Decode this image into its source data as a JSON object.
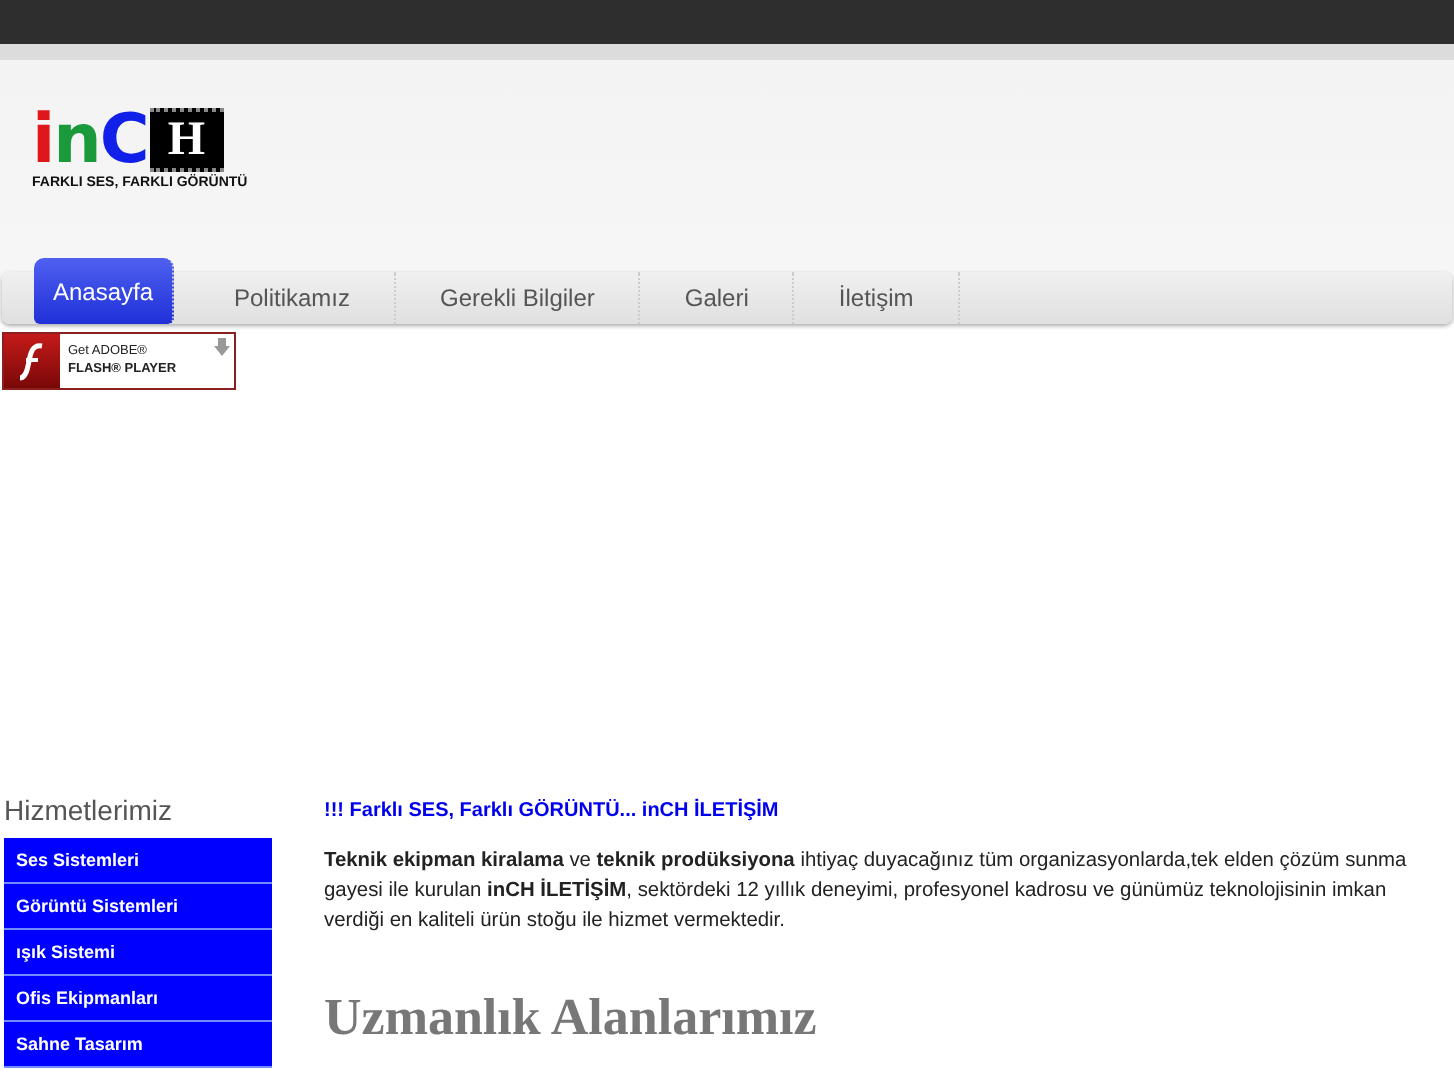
{
  "logo": {
    "mark": "inC",
    "badge": "H",
    "tagline": "FARKLI SES, FARKLI GÖRÜNTÜ"
  },
  "nav": [
    {
      "label": "Anasayfa",
      "selected": true
    },
    {
      "label": "Politikamız",
      "selected": false
    },
    {
      "label": "Gerekli Bilgiler",
      "selected": false
    },
    {
      "label": "Galeri",
      "selected": false
    },
    {
      "label": "İletişim",
      "selected": false
    }
  ],
  "flash_badge": {
    "line1": "Get ADOBE®",
    "line2": "FLASH® PLAYER"
  },
  "sidebar": {
    "title": "Hizmetlerimiz",
    "items": [
      "Ses Sistemleri",
      "Görüntü Sistemleri",
      "ışık Sistemi",
      "Ofis Ekipmanları",
      "Sahne Tasarım"
    ]
  },
  "main": {
    "slogan": "!!! Farklı SES, Farklı GÖRÜNTÜ... inCH İLETİŞİM",
    "intro": "**Teknik ekipman kiralama** ve **teknik prodüksiyona** ihtiyaç duyacağınız tüm organizasyonlarda,tek elden çözüm sunma gayesi ile kurulan **inCH İLETİŞİM**, sektördeki 12 yıllık deneyimi, profesyonel kadrosu ve günümüz teknolojisinin imkan verdiği en kaliteli ürün stoğu ile hizmet vermektedir.",
    "heading": "Uzmanlık Alanlarımız"
  }
}
